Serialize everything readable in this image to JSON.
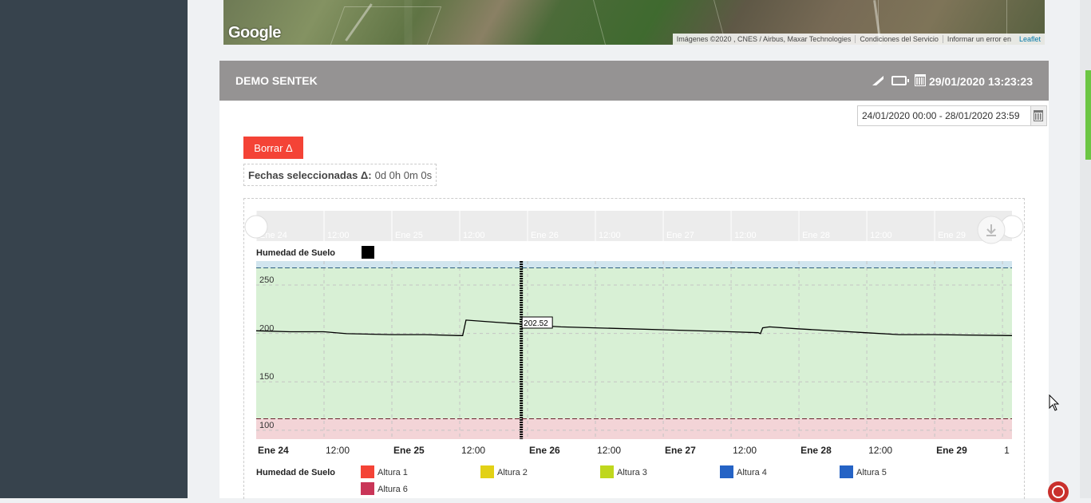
{
  "map": {
    "logo": "Google",
    "attribution": [
      "Imágenes ©2020 , CNES / Airbus, Maxar Technologies",
      "Condiciones del Servicio",
      "Informar un error en"
    ],
    "leaflet_link": "Leaflet"
  },
  "device": {
    "name": "DEMO SENTEK",
    "timestamp": "29/01/2020 13:23:23",
    "icons": [
      "signal-icon",
      "battery-icon",
      "calendar-icon"
    ]
  },
  "controls": {
    "date_range": "24/01/2020 00:00 - 28/01/2020 23:59",
    "clear_button": "Borrar Δ",
    "selected_label": "Fechas seleccionadas Δ:",
    "selected_value": "0d 0h 0m 0s"
  },
  "colors": {
    "header": "#959393",
    "accent_red": "#f44336",
    "zone_high": "#d1e5ee",
    "zone_optimal": "#d8f0d5",
    "zone_low": "#f3d4d7"
  },
  "chart_data": {
    "type": "line",
    "title": "Humedad de Suelo",
    "series_color": "#000000",
    "navigator_ticks": [
      "Ene 24",
      "12:00",
      "Ene 25",
      "12:00",
      "Ene 26",
      "12:00",
      "Ene 27",
      "12:00",
      "Ene 28",
      "12:00",
      "Ene 29"
    ],
    "x_ticks": [
      "Ene 24",
      "12:00",
      "Ene 25",
      "12:00",
      "Ene 26",
      "12:00",
      "Ene 27",
      "12:00",
      "Ene 28",
      "12:00",
      "Ene 29",
      "1"
    ],
    "x_tick_bold": [
      true,
      false,
      true,
      false,
      true,
      false,
      true,
      false,
      true,
      false,
      true,
      false
    ],
    "y_ticks": [
      100,
      150,
      200,
      250
    ],
    "ylim": [
      85,
      269
    ],
    "xlim_hours": [
      0,
      134
    ],
    "thresholds": {
      "upper": 262,
      "lower": 106
    },
    "points": [
      [
        0,
        197
      ],
      [
        6,
        196
      ],
      [
        12,
        196
      ],
      [
        16,
        194
      ],
      [
        24,
        193
      ],
      [
        30,
        193
      ],
      [
        36,
        192
      ],
      [
        36.6,
        192
      ],
      [
        37.2,
        208
      ],
      [
        42,
        206
      ],
      [
        47,
        204
      ],
      [
        48,
        203
      ],
      [
        54,
        201
      ],
      [
        60,
        200
      ],
      [
        72,
        198
      ],
      [
        84,
        196
      ],
      [
        89,
        195
      ],
      [
        89.4,
        194
      ],
      [
        89.8,
        200
      ],
      [
        91,
        201
      ],
      [
        96,
        199
      ],
      [
        108,
        195
      ],
      [
        114,
        193
      ],
      [
        120,
        193
      ],
      [
        134,
        192
      ]
    ],
    "crosshair_hour": 47,
    "tooltip": "202.52",
    "legend_title": "Humedad de Suelo",
    "legend": [
      {
        "name": "Altura 1",
        "color": "#f44336"
      },
      {
        "name": "Altura 2",
        "color": "#e2d116"
      },
      {
        "name": "Altura 3",
        "color": "#bfd71e"
      },
      {
        "name": "Altura 4",
        "color": "#2563c5"
      },
      {
        "name": "Altura 5",
        "color": "#2563c5"
      },
      {
        "name": "Altura 6",
        "color": "#c93658"
      }
    ]
  }
}
